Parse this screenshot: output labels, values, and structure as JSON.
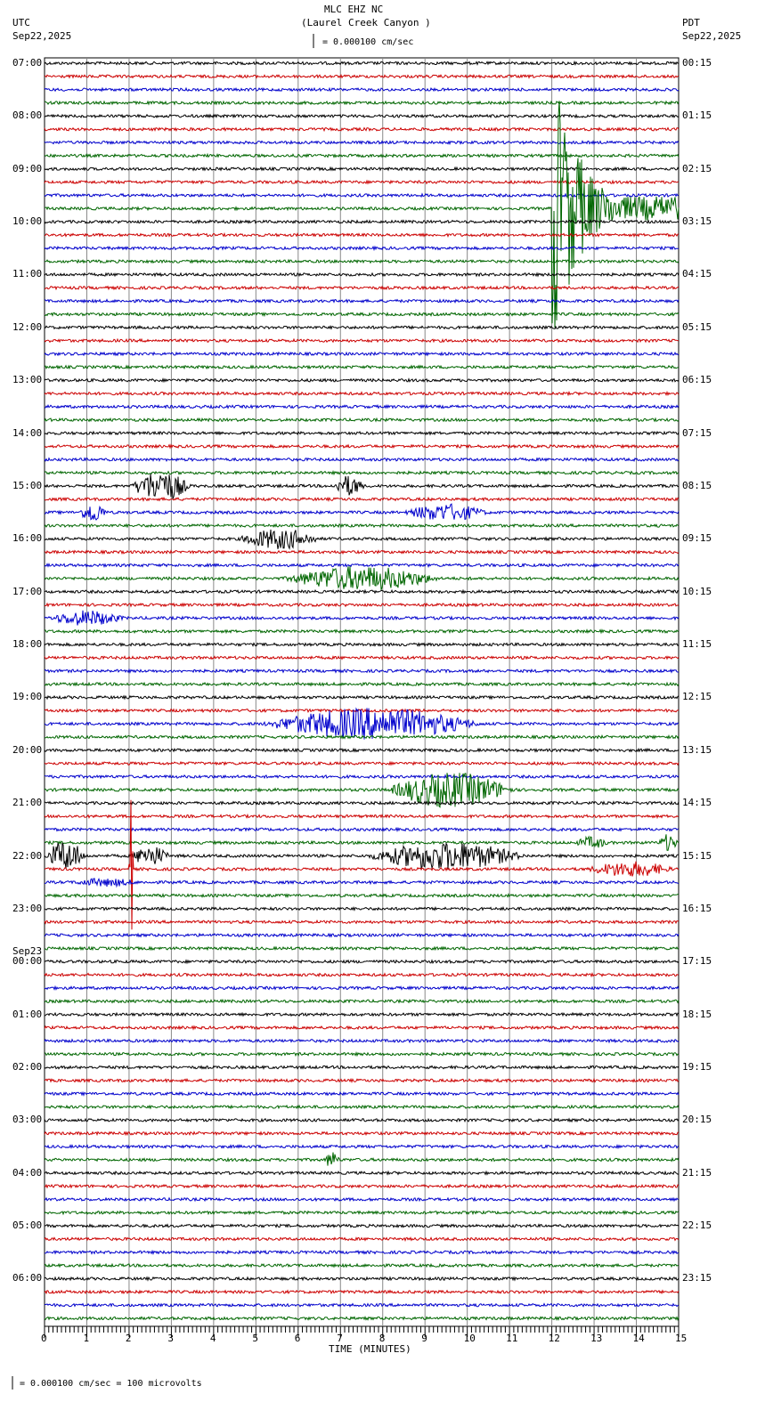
{
  "header": {
    "station": "MLC EHZ NC",
    "location": "(Laurel Creek Canyon )",
    "left_tz": "UTC",
    "left_date": "Sep22,2025",
    "right_tz": "PDT",
    "right_date": "Sep22,2025",
    "scale": "= 0.000100 cm/sec"
  },
  "footer": {
    "scale": "= 0.000100 cm/sec =     100 microvolts"
  },
  "chart_data": {
    "type": "line",
    "title": "MLC EHZ NC (Laurel Creek Canyon )",
    "xlabel": "TIME (MINUTES)",
    "xlim": [
      0,
      15
    ],
    "xticks": [
      "0",
      "1",
      "2",
      "3",
      "4",
      "5",
      "6",
      "7",
      "8",
      "9",
      "10",
      "11",
      "12",
      "13",
      "14",
      "15"
    ],
    "trace_count": 96,
    "trace_colors": [
      "#000000",
      "#cc0000",
      "#0000cc",
      "#006600"
    ],
    "utc_labels": [
      "07:00",
      "08:00",
      "09:00",
      "10:00",
      "11:00",
      "12:00",
      "13:00",
      "14:00",
      "15:00",
      "16:00",
      "17:00",
      "18:00",
      "19:00",
      "20:00",
      "21:00",
      "22:00",
      "23:00",
      "00:00",
      "01:00",
      "02:00",
      "03:00",
      "04:00",
      "05:00",
      "06:00"
    ],
    "date_change_label": "Sep23",
    "pdt_labels": [
      "00:15",
      "01:15",
      "02:15",
      "03:15",
      "04:15",
      "05:15",
      "06:15",
      "07:15",
      "08:15",
      "09:15",
      "10:15",
      "11:15",
      "12:15",
      "13:15",
      "14:15",
      "15:15",
      "16:15",
      "17:15",
      "18:15",
      "19:15",
      "20:15",
      "21:15",
      "22:15",
      "23:15"
    ],
    "events": [
      {
        "trace": 11,
        "start": 12.0,
        "end": 15,
        "amp": 170,
        "decay": true
      },
      {
        "trace": 32,
        "start": 2.0,
        "end": 3.5,
        "amp": 18
      },
      {
        "trace": 32,
        "start": 6.8,
        "end": 7.6,
        "amp": 12
      },
      {
        "trace": 34,
        "start": 0.8,
        "end": 1.5,
        "amp": 12
      },
      {
        "trace": 34,
        "start": 8.4,
        "end": 10.6,
        "amp": 10
      },
      {
        "trace": 36,
        "start": 4.5,
        "end": 6.6,
        "amp": 12
      },
      {
        "trace": 39,
        "start": 5.5,
        "end": 9.5,
        "amp": 14
      },
      {
        "trace": 42,
        "start": 0.0,
        "end": 2.0,
        "amp": 9
      },
      {
        "trace": 50,
        "start": 5.0,
        "end": 10.5,
        "amp": 18
      },
      {
        "trace": 55,
        "start": 8.0,
        "end": 11.2,
        "amp": 20
      },
      {
        "trace": 59,
        "start": 12.5,
        "end": 13.4,
        "amp": 7
      },
      {
        "trace": 59,
        "start": 14.5,
        "end": 15,
        "amp": 10
      },
      {
        "trace": 60,
        "start": 0.0,
        "end": 1.0,
        "amp": 18
      },
      {
        "trace": 60,
        "start": 2.0,
        "end": 3.0,
        "amp": 12
      },
      {
        "trace": 60,
        "start": 7.5,
        "end": 11.5,
        "amp": 16
      },
      {
        "trace": 61,
        "start": 12.7,
        "end": 15,
        "amp": 9
      },
      {
        "trace": 61,
        "start": 2.0,
        "end": 2.1,
        "amp": 80
      },
      {
        "trace": 62,
        "start": 0.5,
        "end": 2.4,
        "amp": 5
      },
      {
        "trace": 83,
        "start": 6.6,
        "end": 7.0,
        "amp": 10
      }
    ]
  }
}
